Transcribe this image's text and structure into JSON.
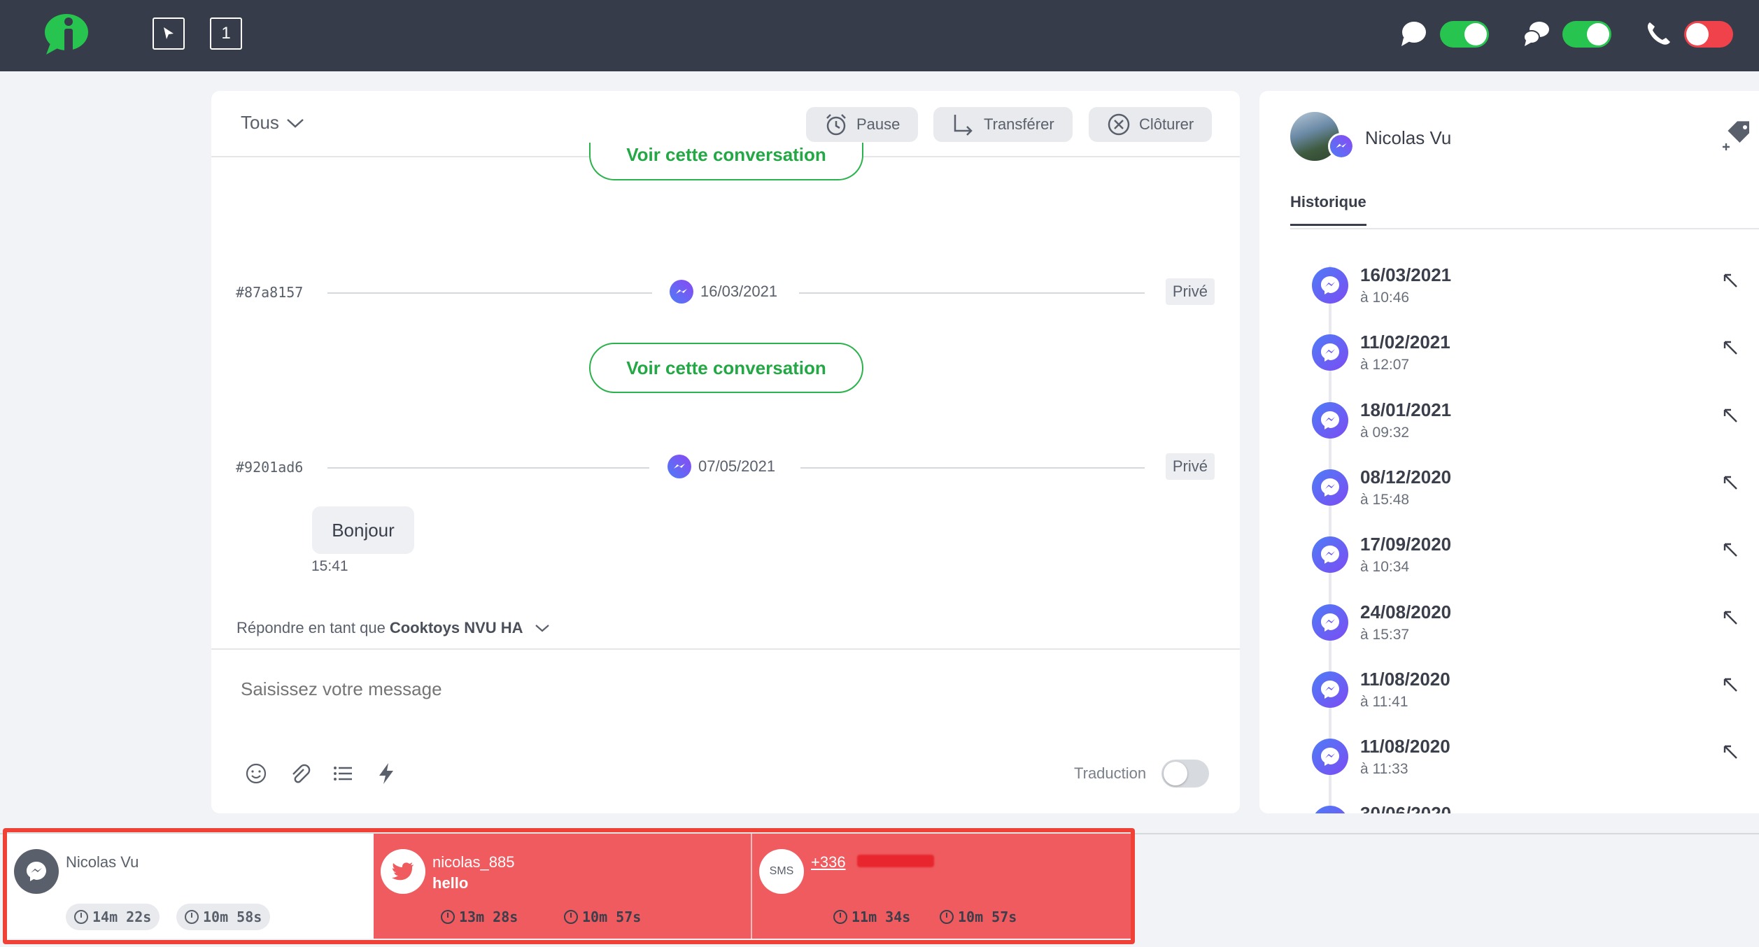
{
  "topbar": {
    "counter_label": "1",
    "colors": {
      "bg": "#363c4a",
      "brand": "#27c44f",
      "toggle_on": "#27c44f",
      "toggle_off": "#f0424b"
    },
    "toggles": [
      {
        "icon": "chat-bubble-icon",
        "state": "on"
      },
      {
        "icon": "chat-bubbles-icon",
        "state": "on"
      },
      {
        "icon": "phone-icon",
        "state": "off"
      }
    ]
  },
  "chat": {
    "filter_label": "Tous",
    "actions": {
      "pause": "Pause",
      "transfer": "Transférer",
      "close": "Clôturer"
    },
    "voir_label": "Voir cette conversation",
    "separators": [
      {
        "id": "#87a8157",
        "date": "16/03/2021",
        "badge": "Privé"
      },
      {
        "id": "#9201ad6",
        "date": "07/05/2021",
        "badge": "Privé"
      }
    ],
    "message": {
      "text": "Bonjour",
      "time": "15:41"
    },
    "reply_as_prefix": "Répondre en tant que",
    "reply_as_name": "Cooktoys NVU HA",
    "composer_placeholder": "Saisissez votre message",
    "translation_label": "Traduction",
    "translation_enabled": false
  },
  "contact": {
    "name": "Nicolas Vu",
    "tab_label": "Historique",
    "history": [
      {
        "date": "16/03/2021",
        "time": "à 10:46"
      },
      {
        "date": "11/02/2021",
        "time": "à 12:07"
      },
      {
        "date": "18/01/2021",
        "time": "à 09:32"
      },
      {
        "date": "08/12/2020",
        "time": "à 15:48"
      },
      {
        "date": "17/09/2020",
        "time": "à 10:34"
      },
      {
        "date": "24/08/2020",
        "time": "à 15:37"
      },
      {
        "date": "11/08/2020",
        "time": "à 11:41"
      },
      {
        "date": "11/08/2020",
        "time": "à 11:33"
      },
      {
        "date": "30/06/2020",
        "time": ""
      }
    ]
  },
  "conversations": [
    {
      "channel": "messenger-icon",
      "name": "Nicolas Vu",
      "message": "",
      "timer1": "14m 22s",
      "timer2": "10m 58s",
      "state": "active"
    },
    {
      "channel": "twitter-icon",
      "name": "nicolas_885",
      "message": "hello",
      "timer1": "13m 28s",
      "timer2": "10m 57s",
      "state": "alert"
    },
    {
      "channel": "sms-icon",
      "channel_label": "SMS",
      "name": "+336",
      "message": "",
      "timer1": "11m 34s",
      "timer2": "10m 57s",
      "state": "alert"
    }
  ]
}
